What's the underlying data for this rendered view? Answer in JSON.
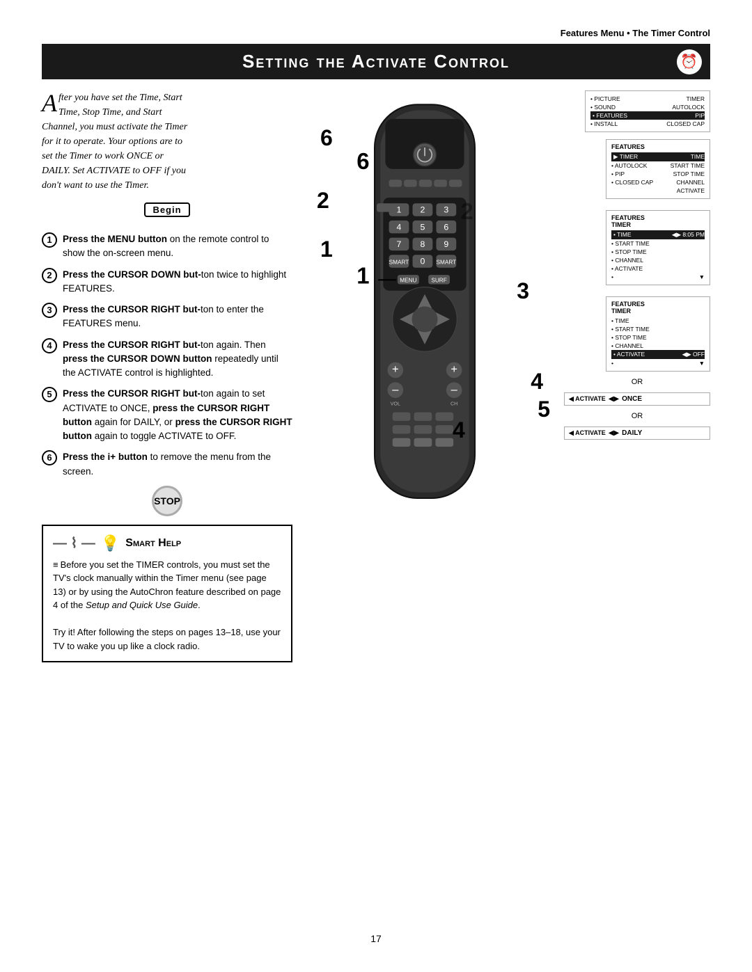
{
  "header": {
    "breadcrumb": "Features Menu • The Timer Control"
  },
  "title": {
    "text": "Setting the Activate Control",
    "small_caps_style": true
  },
  "intro": {
    "drop_cap": "A",
    "text": "fter you have set the Time, Start Time, Stop Time, and Start Channel, you must activate the Timer for it to operate. Your options are to set the Timer to work ONCE or DAILY. Set ACTIVATE to OFF if you don't want to use the Timer."
  },
  "begin_label": "Begin",
  "steps": [
    {
      "num": "1",
      "bold": "Press the MENU button",
      "text": " on the remote control to show the on-screen menu."
    },
    {
      "num": "2",
      "bold": "Press the CURSOR DOWN but-",
      "text": "ton twice to highlight FEATURES."
    },
    {
      "num": "3",
      "bold": "Press the CURSOR RIGHT but-",
      "text": "ton to enter the FEATURES menu."
    },
    {
      "num": "4",
      "bold": "Press the CURSOR RIGHT but-",
      "text": "ton again. Then press the CURSOR DOWN button repeatedly until the ACTIVATE control is highlighted."
    },
    {
      "num": "5",
      "bold": "Press the CURSOR RIGHT but-",
      "text": "ton again to set ACTIVATE to ONCE, press the CURSOR RIGHT button again for DAILY, or press the CURSOR RIGHT button again to toggle ACTIVATE to OFF."
    },
    {
      "num": "6",
      "bold": "Press the i+ button",
      "text": " to remove the menu from the screen."
    }
  ],
  "smart_help": {
    "title": "Smart Help",
    "text1": "Before you set the TIMER controls, you must set the TV's clock manually within the Timer menu (see page 13) or by using the AutoChron feature described on page 4 of the ",
    "text1_italic": "Setup and Quick Use Guide",
    "text2": ".",
    "text3": "Try it! After following the steps on pages 13–18, use your TV to wake you up like a clock radio."
  },
  "panels": {
    "panel1": {
      "rows": [
        {
          "left": "• PICTURE",
          "right": "TIMER"
        },
        {
          "left": "• SOUND",
          "right": "AUTOLOCK"
        },
        {
          "left": "• FEATURES",
          "right": "PIP",
          "highlight": true
        },
        {
          "left": "• INSTALL",
          "right": "CLOSED CAP"
        }
      ]
    },
    "panel2": {
      "title": "FEATURES",
      "rows": [
        {
          "left": "▶ TIMER",
          "right": "TIME",
          "highlight": true
        },
        {
          "left": "• AUTOLOCK",
          "right": "START TIME"
        },
        {
          "left": "• PIP",
          "right": "STOP TIME"
        },
        {
          "left": "• CLOSED CAP",
          "right": "CHANNEL"
        },
        {
          "left": "",
          "right": "ACTIVATE"
        }
      ]
    },
    "panel3": {
      "title": "FEATURES",
      "subtitle": "TIMER",
      "rows": [
        {
          "left": "• TIME",
          "right": "◀▶  8:05 PM",
          "highlight": true
        },
        {
          "left": "• START TIME",
          "right": ""
        },
        {
          "left": "• STOP TIME",
          "right": ""
        },
        {
          "left": "• CHANNEL",
          "right": ""
        },
        {
          "left": "• ACTIVATE",
          "right": ""
        },
        {
          "left": "•",
          "right": "▼"
        }
      ]
    },
    "panel4": {
      "title": "FEATURES",
      "subtitle": "TIMER",
      "rows": [
        {
          "left": "• TIME",
          "right": ""
        },
        {
          "left": "• START TIME",
          "right": ""
        },
        {
          "left": "• STOP TIME",
          "right": ""
        },
        {
          "left": "• CHANNEL",
          "right": ""
        },
        {
          "left": "• ACTIVATE",
          "right": "◀▶  OFF",
          "highlight": true
        },
        {
          "left": "•",
          "right": "▼"
        }
      ]
    }
  },
  "activate_rows": [
    {
      "key": "◀ ACTIVATE",
      "arrow": "◀▶",
      "val": "ONCE"
    },
    {
      "key": "◀ ACTIVATE",
      "arrow": "◀▶",
      "val": "DAILY"
    }
  ],
  "or_labels": [
    "OR",
    "OR"
  ],
  "callout_numbers": [
    "6",
    "1",
    "3",
    "4",
    "5",
    "4",
    "2"
  ],
  "page_number": "17"
}
